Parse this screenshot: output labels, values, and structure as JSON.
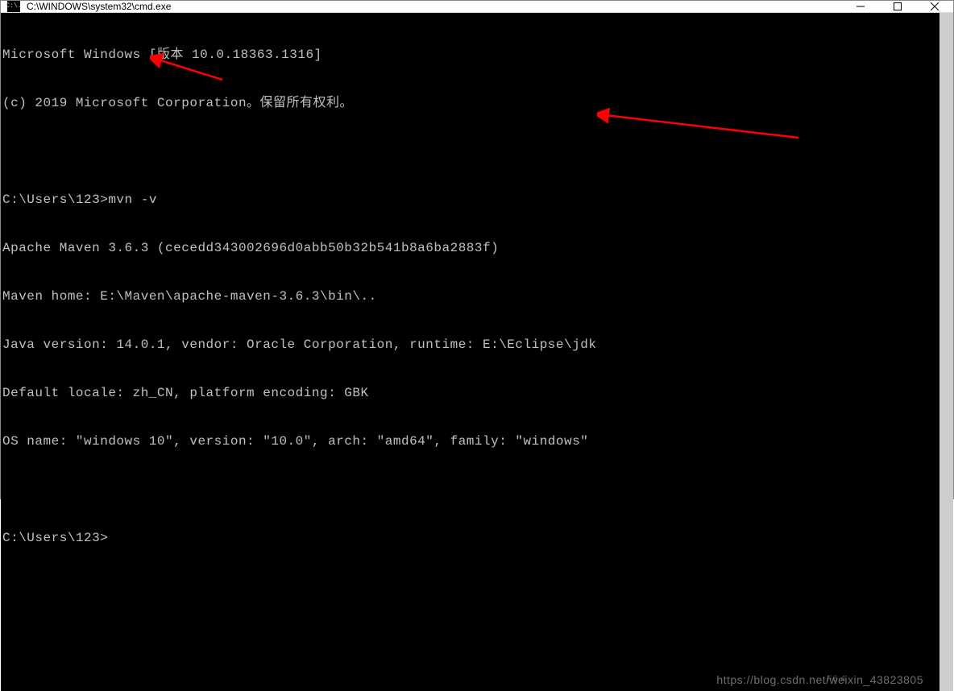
{
  "titlebar": {
    "icon_text": "C:\\.",
    "title": "C:\\WINDOWS\\system32\\cmd.exe"
  },
  "terminal": {
    "lines": [
      "Microsoft Windows [版本 10.0.18363.1316]",
      "(c) 2019 Microsoft Corporation。保留所有权利。",
      "",
      "C:\\Users\\123>mvn -v",
      "Apache Maven 3.6.3 (cecedd343002696d0abb50b32b541b8a6ba2883f)",
      "Maven home: E:\\Maven\\apache-maven-3.6.3\\bin\\..",
      "Java version: 14.0.1, vendor: Oracle Corporation, runtime: E:\\Eclipse\\jdk",
      "Default locale: zh_CN, platform encoding: GBK",
      "OS name: \"windows 10\", version: \"10.0\", arch: \"amd64\", family: \"windows\"",
      "",
      "C:\\Users\\123>"
    ]
  },
  "watermark": "https://blog.csdn.net/weixin_43823805",
  "page_indicator": "F6 4"
}
